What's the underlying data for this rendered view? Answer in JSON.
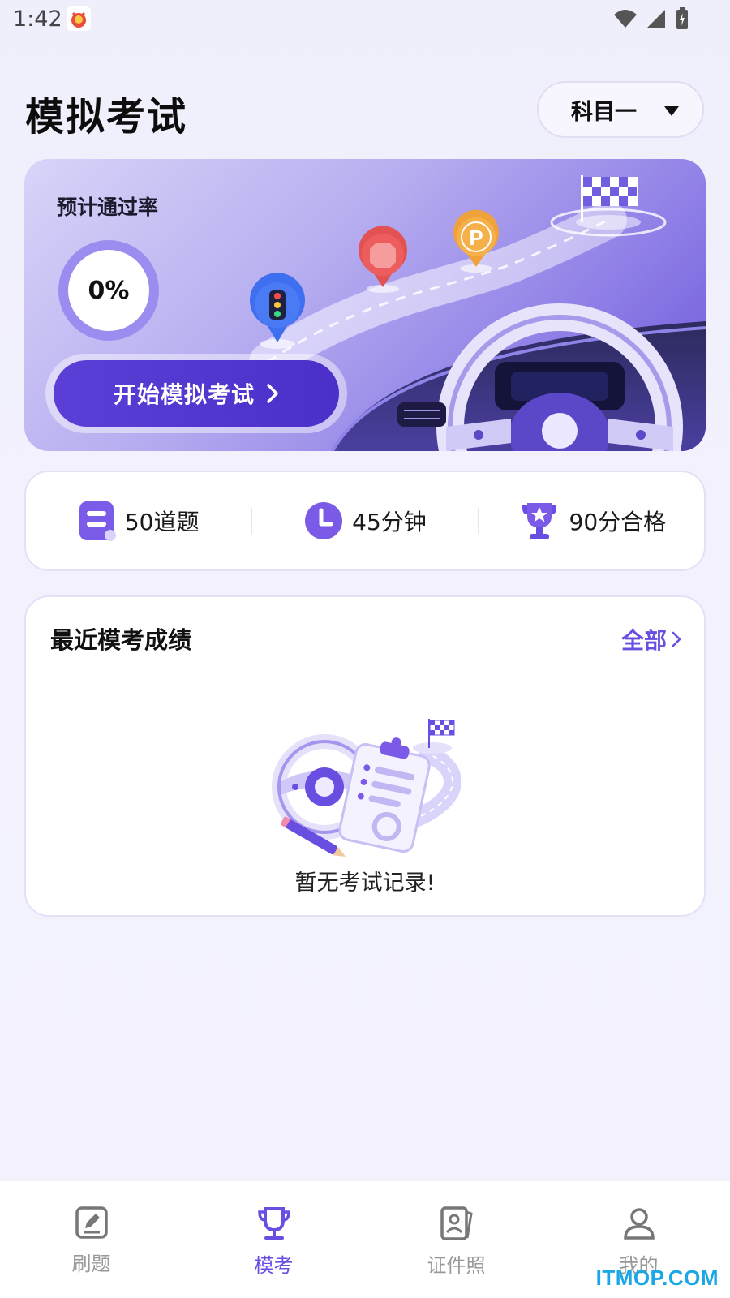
{
  "status_bar": {
    "time": "1:42"
  },
  "header": {
    "title": "模拟考试",
    "subject": "科目一"
  },
  "hero": {
    "label": "预计通过率",
    "pass_rate": "0%",
    "start_button": "开始模拟考试",
    "sign_letter": "P"
  },
  "info": {
    "questions": "50道题",
    "duration": "45分钟",
    "pass_score": "90分合格"
  },
  "records": {
    "title": "最近模考成绩",
    "all_link": "全部",
    "empty_text": "暂无考试记录!"
  },
  "nav": {
    "items": [
      {
        "label": "刷题",
        "icon": "edit-note-icon"
      },
      {
        "label": "模考",
        "icon": "trophy-icon"
      },
      {
        "label": "证件照",
        "icon": "id-photo-icon"
      },
      {
        "label": "我的",
        "icon": "user-icon"
      }
    ],
    "active_index": 1
  },
  "watermark": "ITMOP.COM",
  "colors": {
    "accent": "#6a4ee2",
    "button": "#5b3fd6"
  }
}
